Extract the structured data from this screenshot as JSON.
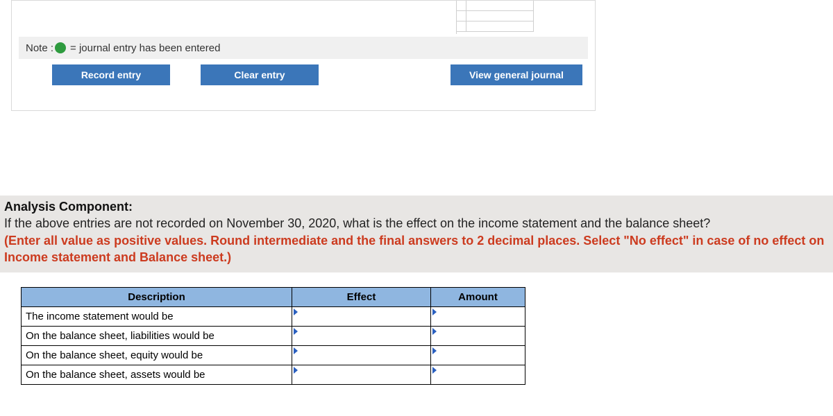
{
  "note": {
    "label": "Note :",
    "text": "= journal entry has been entered"
  },
  "buttons": {
    "record": "Record entry",
    "clear": "Clear entry",
    "view": "View general journal"
  },
  "analysis": {
    "heading": "Analysis Component:",
    "question": "If the above entries are not recorded on November 30, 2020, what is the effect on the income statement and the balance sheet?",
    "instruction": "(Enter all value as positive values. Round intermediate and the final answers to 2 decimal places. Select \"No effect\" in case of no effect on Income statement and Balance sheet.)"
  },
  "table": {
    "headers": {
      "description": "Description",
      "effect": "Effect",
      "amount": "Amount"
    },
    "rows": [
      {
        "description": "The income statement would be",
        "effect": "",
        "amount": ""
      },
      {
        "description": "On the balance sheet, liabilities would be",
        "effect": "",
        "amount": ""
      },
      {
        "description": "On the balance sheet, equity would be",
        "effect": "",
        "amount": ""
      },
      {
        "description": "On the balance sheet, assets would be",
        "effect": "",
        "amount": ""
      }
    ]
  }
}
